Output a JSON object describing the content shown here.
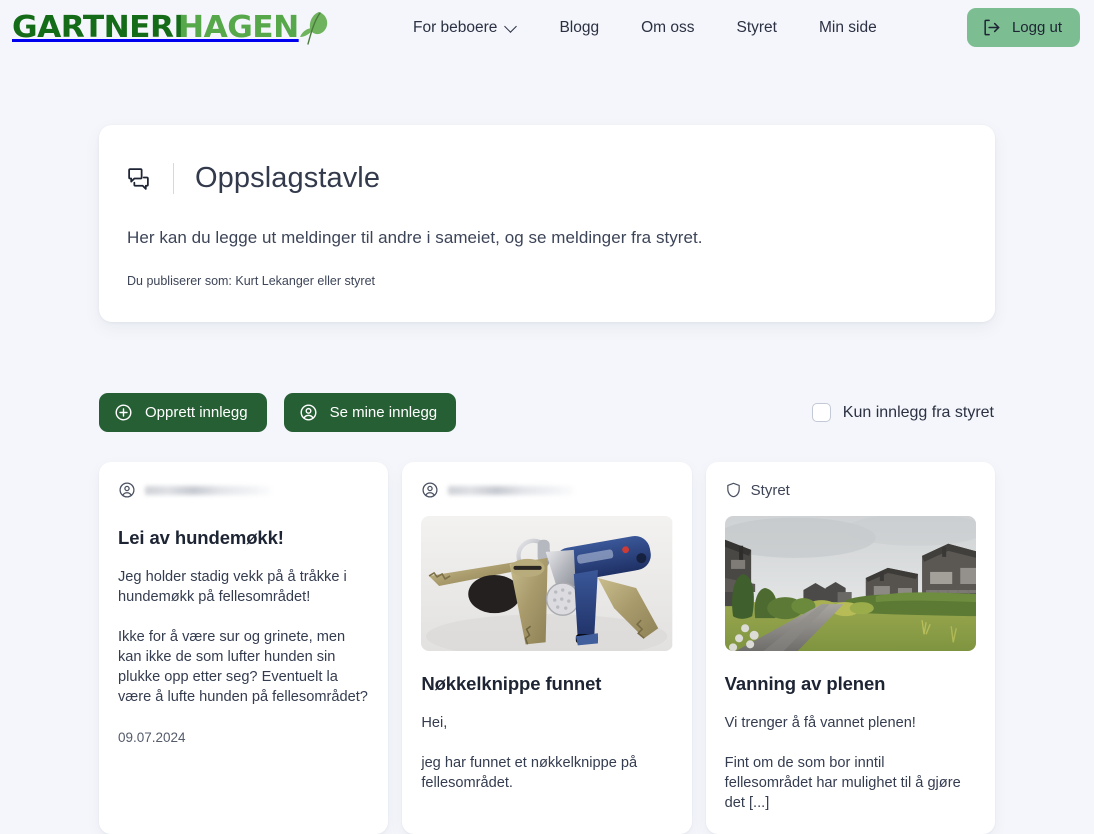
{
  "header": {
    "logo": {
      "part1": "GARTNERI",
      "part2": "HAGEN",
      "leaf_icon": "leaf-icon"
    },
    "nav": [
      {
        "label": "For beboere",
        "has_dropdown": true
      },
      {
        "label": "Blogg",
        "has_dropdown": false
      },
      {
        "label": "Om oss",
        "has_dropdown": false
      },
      {
        "label": "Styret",
        "has_dropdown": false
      },
      {
        "label": "Min side",
        "has_dropdown": false
      }
    ],
    "logout": {
      "label": "Logg ut",
      "icon": "logout-icon",
      "bg": "#7dbd92"
    }
  },
  "intro": {
    "icon": "message-bubbles-icon",
    "title": "Oppslagstavle",
    "lead": "Her kan du legge ut meldinger til andre i sameiet, og se meldinger fra styret.",
    "publishing_as": "Du publiserer som: Kurt Lekanger eller styret"
  },
  "actions": {
    "create_post": {
      "label": "Opprett innlegg",
      "icon": "plus-circle-icon"
    },
    "my_posts": {
      "label": "Se mine innlegg",
      "icon": "user-circle-icon"
    },
    "filter": {
      "label": "Kun innlegg fra styret",
      "checked": false
    },
    "button_color": "#265f34"
  },
  "posts": [
    {
      "author": "",
      "author_redacted": true,
      "author_icon": "user-circle-icon",
      "has_photo": false,
      "photo_alt": "",
      "title": "Lei av hundemøkk!",
      "body": "Jeg holder stadig vekk på å tråkke i hundemøkk på fellesområdet!\n\nIkke for å være sur og grinete, men kan ikke de som lufter hunden sin plukke opp etter seg? Eventuelt la være å lufte hunden på fellesområdet?",
      "date": "09.07.2024"
    },
    {
      "author": "",
      "author_redacted": true,
      "author_icon": "user-circle-icon",
      "has_photo": true,
      "photo_alt": "Nøkkelknippe med flere nøkler på hvitt underlag",
      "title": "Nøkkelknippe funnet",
      "body": "Hei,\n\njeg har funnet et nøkkelknippe på fellesområdet.",
      "date": ""
    },
    {
      "author": "Styret",
      "author_redacted": false,
      "author_icon": "shield-icon",
      "has_photo": true,
      "photo_alt": "Boligfelt med rekkehus, hekk, plen og grusvei",
      "title": "Vanning av plenen",
      "body": "Vi trenger å få vannet plenen!\n\nFint om de som bor inntil fellesområdet har mulighet til å gjøre det [...]",
      "date": ""
    }
  ]
}
